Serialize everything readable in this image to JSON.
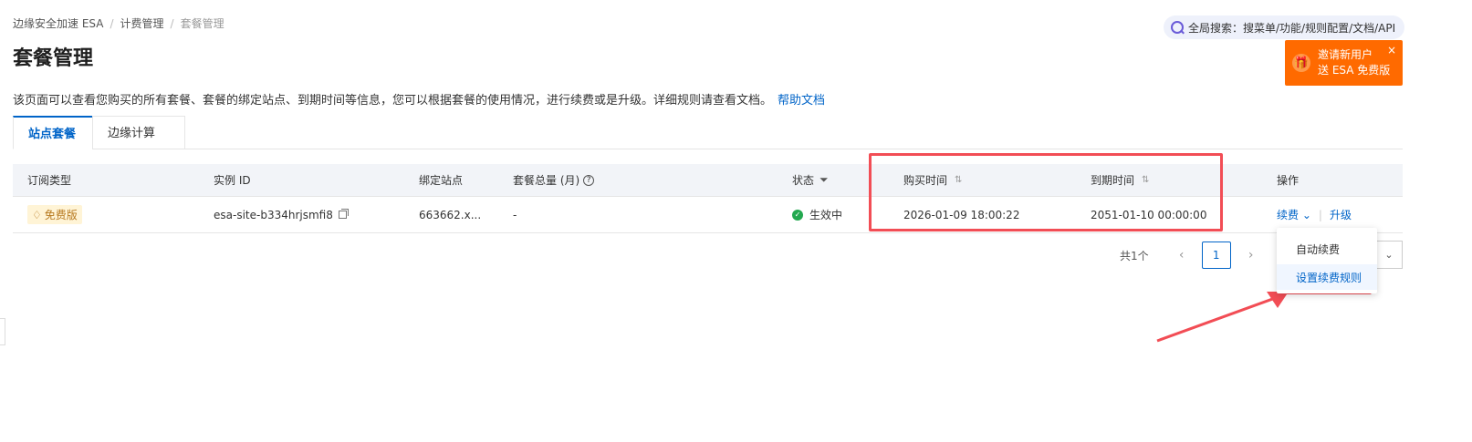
{
  "breadcrumb": {
    "items": [
      "边缘安全加速 ESA",
      "计费管理",
      "套餐管理"
    ],
    "separator": "/"
  },
  "page": {
    "title": "套餐管理",
    "description": "该页面可以查看您购买的所有套餐、套餐的绑定站点、到期时间等信息，您可以根据套餐的使用情况，进行续费或是升级。详细规则请查看文档。",
    "help_link": "帮助文档"
  },
  "global_search": {
    "label": "全局搜索：搜菜单/功能/规则配置/文档/API"
  },
  "promo": {
    "line1": "邀请新用户",
    "line2": "送 ESA 免费版",
    "close": "×",
    "color": "#ff6a00"
  },
  "tabs": [
    {
      "label": "站点套餐",
      "active": true
    },
    {
      "label": "边缘计算",
      "active": false
    }
  ],
  "table": {
    "headers": {
      "type": "订阅类型",
      "instance": "实例 ID",
      "site": "绑定站点",
      "quota": "套餐总量 (月)",
      "status": "状态",
      "purchase": "购买时间",
      "expire": "到期时间",
      "actions": "操作"
    },
    "rows": [
      {
        "type": "免费版",
        "instance": "esa-site-b334hrjsmfi8",
        "site": "663662.x...",
        "quota": "-",
        "status": "生效中",
        "purchase": "2026-01-09 18:00:22",
        "expire": "2051-01-10 00:00:00",
        "renew": "续费",
        "upgrade": "升级"
      }
    ]
  },
  "pagination": {
    "total": "共1个",
    "current_page": "1"
  },
  "dropdown": {
    "items": [
      "自动续费",
      "设置续费规则"
    ]
  },
  "colors": {
    "accent": "#0064c8",
    "highlight": "#f24d55",
    "status_active": "#23a84f"
  }
}
